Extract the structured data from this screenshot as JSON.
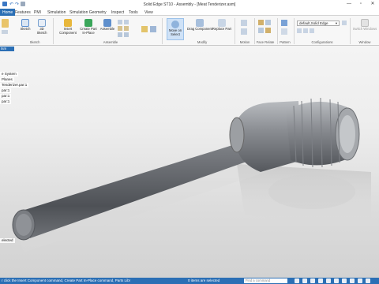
{
  "titlebar": {
    "title": "Solid Edge ST10 - Assembly - [Meat Tenderizer.asm]",
    "minimize": "—",
    "restore": "▫",
    "close": "✕"
  },
  "tabs": [
    {
      "label": "Home",
      "active": true
    },
    {
      "label": "Features"
    },
    {
      "label": "PMI"
    },
    {
      "label": "Simulation"
    },
    {
      "label": "Simulation Geometry"
    },
    {
      "label": "Inspect"
    },
    {
      "label": "Tools"
    },
    {
      "label": "View"
    }
  ],
  "ribbon": {
    "sketch": "Sketch",
    "sketch_3d": "3D Sketch",
    "insert_component": "Insert Component",
    "create_part": "Create Part In-Place",
    "assemble": "Assemble",
    "move_on_select": "Move on Select",
    "drag_component": "Drag Component",
    "replace_part": "Replace Part",
    "groups": {
      "sketch": "Sketch",
      "assemble": "Assemble",
      "modify": "Modify",
      "motion": "Motion",
      "face_relate": "Face Relate",
      "pattern": "Pattern",
      "configurations": "Configurations",
      "window": "Window"
    },
    "config_value": "default,Solid Edge",
    "switch_windows": "Switch Windows"
  },
  "pathfinder": {
    "tab_label": "tsm",
    "items": [
      "e System",
      "Planes",
      "Tenderizer.par:1",
      "par:1",
      "par:1",
      "par:1",
      "elected"
    ]
  },
  "status": {
    "message": "r click the Insert Component command, Create Part In-Place command, Parts Libr",
    "selected": "0 items are selected",
    "find_placeholder": "Find a command"
  },
  "colors": {
    "accent": "#2b6fb5",
    "highlight": "#cfe2f7"
  }
}
